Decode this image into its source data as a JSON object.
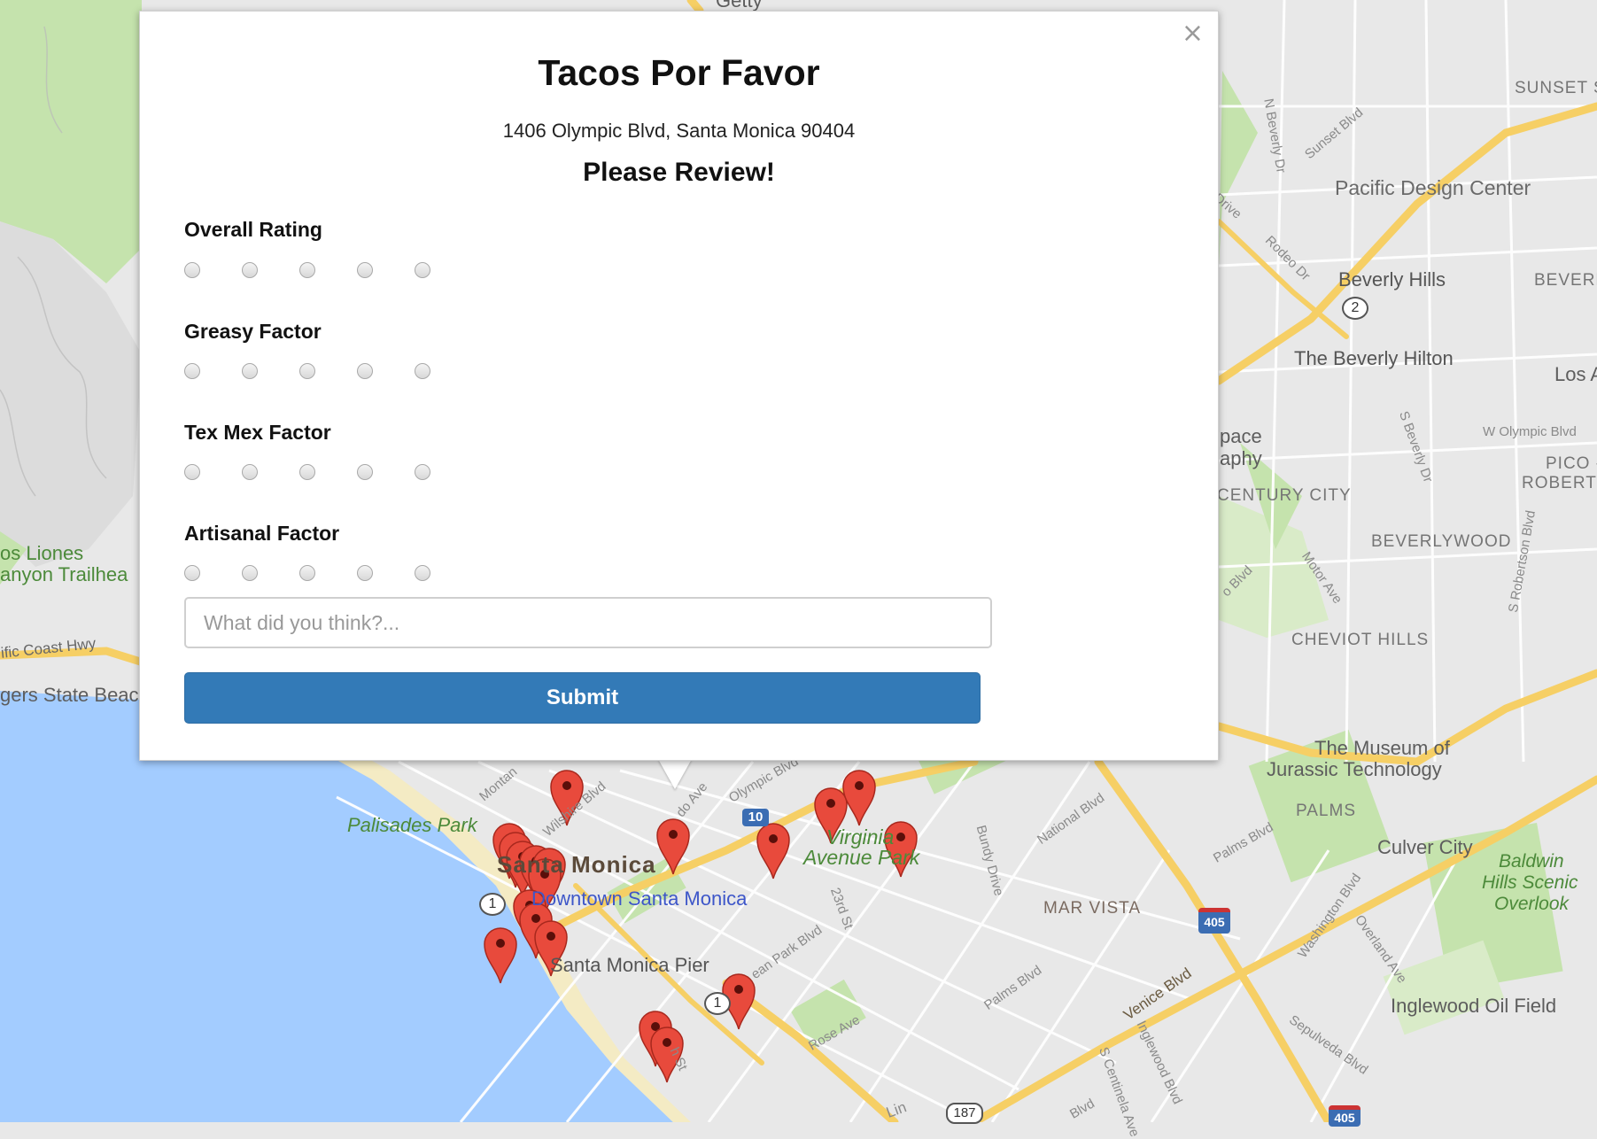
{
  "popup": {
    "close_symbol": "×",
    "title": "Tacos Por Favor",
    "address": "1406 Olympic Blvd, Santa Monica 90404",
    "subtitle": "Please Review!",
    "rating_groups": [
      {
        "label": "Overall Rating",
        "options": 5,
        "selected": null
      },
      {
        "label": "Greasy Factor",
        "options": 5,
        "selected": null
      },
      {
        "label": "Tex Mex Factor",
        "options": 5,
        "selected": null
      },
      {
        "label": "Artisanal Factor",
        "options": 5,
        "selected": null
      }
    ],
    "comment_value": "",
    "comment_placeholder": "What did you think?...",
    "submit_label": "Submit"
  },
  "map": {
    "colors": {
      "land": "#e8e8e8",
      "water": "#a3ccff",
      "park": "#c5e3ad",
      "highway": "#f6cf65",
      "road": "#ffffff",
      "pin": "#e84a3c"
    },
    "labels": {
      "sunset_st": "SUNSET S",
      "pacific_design_center": "Pacific Design Center",
      "beverly_hills": "Beverly Hills",
      "beverl": "BEVERL",
      "beverly_hilton": "The Beverly Hilton",
      "los": "Los A",
      "w_olympic_blvd": "W Olympic Blvd",
      "pico": "PICO -",
      "roberts": "ROBERTS",
      "space": "pace",
      "aphy": "aphy",
      "century_city": "CENTURY CITY",
      "beverlywood": "BEVERLYWOOD",
      "cheviot_hills": "CHEVIOT HILLS",
      "museum_jurassic_1": "The Museum of",
      "museum_jurassic_2": "Jurassic Technology",
      "palms": "PALMS",
      "culver_city": "Culver City",
      "baldwin_1": "Baldwin",
      "baldwin_2": "Hills Scenic",
      "baldwin_3": "Overlook",
      "mar_vista": "MAR VISTA",
      "inglewood_oil": "Inglewood Oil Field",
      "los_liones": "os Liones",
      "canyon_trailhead": "anyon Trailhea",
      "pacific_coast_hwy": "ific Coast Hwy",
      "rogers_state_beach": "gers State Beac",
      "palisades_park": "Palisades Park",
      "santa_monica": "Santa Monica",
      "downtown_santa_monica": "Downtown Santa Monica",
      "santa_monica_pier": "Santa Monica Pier",
      "virginia_park_1": "Virginia",
      "virginia_park_2": "Avenue Park",
      "getty": "Getty",
      "sunset_blvd": "Sunset Blvd",
      "n_beverly_dr": "N Beverly Dr",
      "rodeo_dr": "Rodeo Dr",
      "drive": "Drive",
      "s_beverly_dr": "S Beverly Dr",
      "motor_ave": "Motor Ave",
      "s_robertson_blvd": "S Robertson Blvd",
      "o_blvd": "o Blvd",
      "national_blvd": "National Blvd",
      "palms_blvd": "Palms Blvd",
      "palms_blvd_2": "Palms Blvd",
      "washington_blvd": "Washington Blvd",
      "overland_ave": "Overland Ave",
      "sepulveda_blvd": "Sepulveda Blvd",
      "venice_blvd": "Venice Blvd",
      "inglewood_blvd": "Inglewood Blvd",
      "s_centinela": "S Centinela Ave",
      "bundy_drive": "Bundy Drive",
      "ocean_park_blvd": "ean Park Blvd",
      "23rd_st": "23rd St",
      "rose_ave": "Rose Ave",
      "wilshire_blvd": "Wilshire Blvd",
      "olympic_blvd": "Olympic Blvd",
      "montana": "Montan",
      "cloverfield": "do Ave",
      "lincoln": "Lin",
      "blvd_bottom": "Blvd",
      "h_st": "h St"
    },
    "shields": {
      "r1a": "1",
      "r1b": "1",
      "r2": "2",
      "i10": "10",
      "i405a": "405",
      "i405b": "405",
      "r187": "187"
    }
  }
}
